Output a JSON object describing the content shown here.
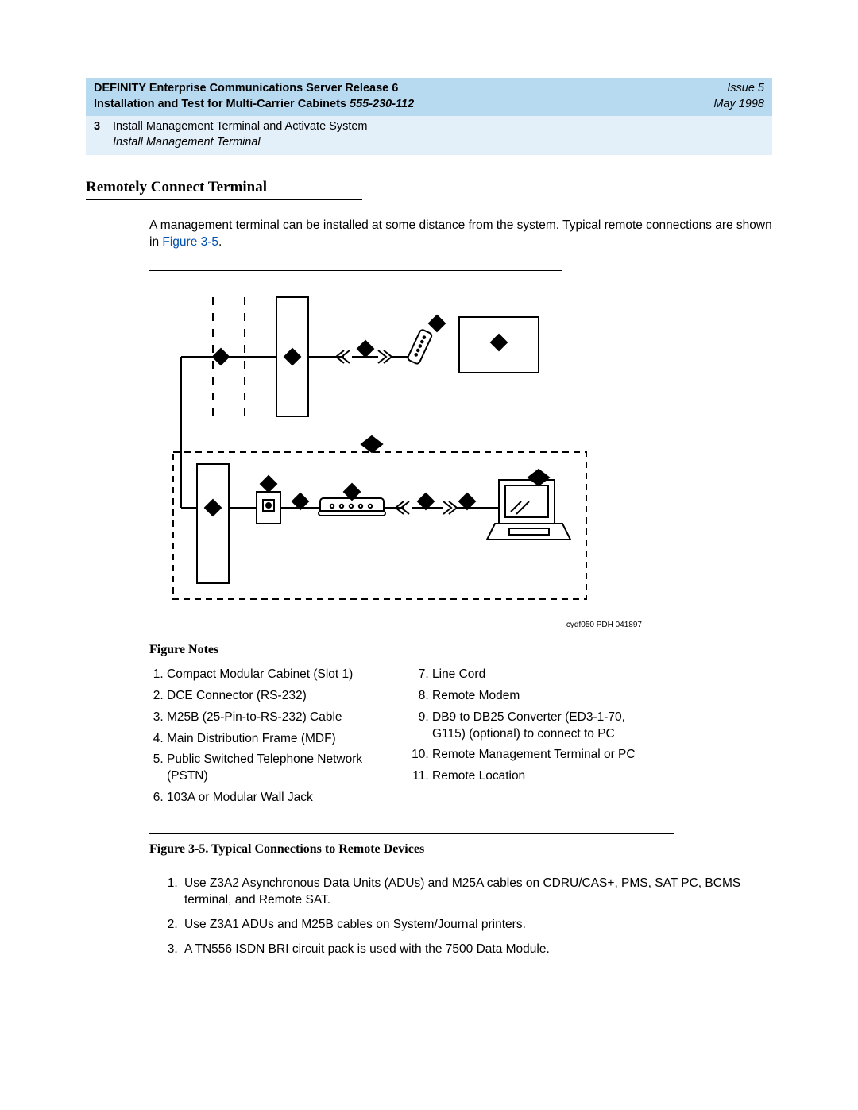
{
  "header": {
    "title": "DEFINITY Enterprise Communications Server Release 6",
    "subtitle_prefix": "Installation and Test for Multi-Carrier Cabinets  ",
    "docnum": "555-230-112",
    "issue": "Issue 5",
    "date": "May 1998",
    "chapnum": "3",
    "chaptitle": "Install Management Terminal and Activate System",
    "chapsub": "Install Management Terminal"
  },
  "section_title": "Remotely Connect Terminal",
  "intro_text_a": "A management terminal can be installed at some distance from the system. Typical remote connections are shown in ",
  "intro_link": "Figure 3-5",
  "intro_text_b": ".",
  "figure_credit": "cydf050 PDH 041897",
  "figure_notes_heading": "Figure Notes",
  "notes_left": [
    "Compact Modular Cabinet (Slot 1)",
    "DCE Connector (RS-232)",
    "M25B (25-Pin-to-RS-232) Cable",
    "Main Distribution Frame (MDF)",
    "Public Switched Telephone Network (PSTN)",
    "103A or Modular Wall Jack"
  ],
  "notes_right": [
    "Line Cord",
    "Remote Modem",
    "DB9 to DB25 Converter (ED3-1-70, G115) (optional) to connect to PC",
    "Remote Management Terminal or PC",
    "Remote Location"
  ],
  "figure_caption": "Figure 3-5.   Typical Connections to Remote Devices",
  "typical": [
    "Use Z3A2 Asynchronous Data Units (ADUs) and M25A cables on CDRU/CAS+, PMS, SAT PC, BCMS terminal, and Remote SAT.",
    "Use Z3A1 ADUs and M25B cables on System/Journal printers.",
    "A TN556 ISDN BRI circuit pack is used with the 7500 Data Module."
  ]
}
